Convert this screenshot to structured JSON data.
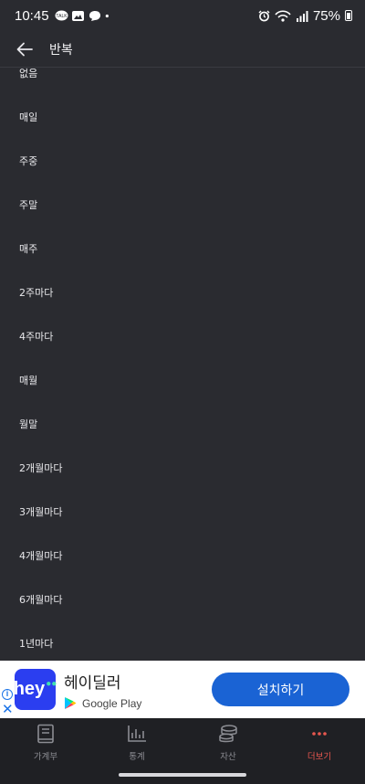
{
  "status_bar": {
    "time": "10:45",
    "battery_percent": "75%"
  },
  "header": {
    "title": "반복"
  },
  "repeat_options": [
    "없음",
    "매일",
    "주중",
    "주말",
    "매주",
    "2주마다",
    "4주마다",
    "매월",
    "월말",
    "2개월마다",
    "3개월마다",
    "4개월마다",
    "6개월마다",
    "1년마다"
  ],
  "ad": {
    "logo_text": "hey",
    "title": "헤이딜러",
    "store": "Google Play",
    "cta": "설치하기"
  },
  "tabs": [
    {
      "label": "가계부",
      "icon": "book-icon",
      "active": false
    },
    {
      "label": "통계",
      "icon": "bar-chart-icon",
      "active": false
    },
    {
      "label": "자산",
      "icon": "coins-icon",
      "active": false
    },
    {
      "label": "더보기",
      "icon": "more-dots-icon",
      "active": true
    }
  ],
  "colors": {
    "background": "#2a2b30",
    "tab_bar": "#1f2024",
    "accent": "#e8574f",
    "ad_cta": "#1a63d4"
  }
}
